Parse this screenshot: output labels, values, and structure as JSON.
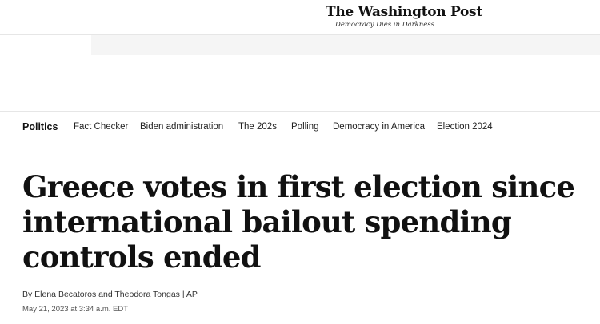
{
  "masthead": {
    "logo": "The Washington Post",
    "tagline": "Democracy Dies in Darkness"
  },
  "subnav": {
    "section": "Politics",
    "items": [
      "Fact Checker",
      "Biden administration",
      "The 202s",
      "Polling",
      "Democracy in America",
      "Election 2024"
    ]
  },
  "article": {
    "headline": "Greece votes in first election since international bailout spending controls ended",
    "byline": "By Elena Becatoros and Theodora Tongas | AP",
    "dateline": "May 21, 2023 at 3:34 a.m. EDT"
  }
}
